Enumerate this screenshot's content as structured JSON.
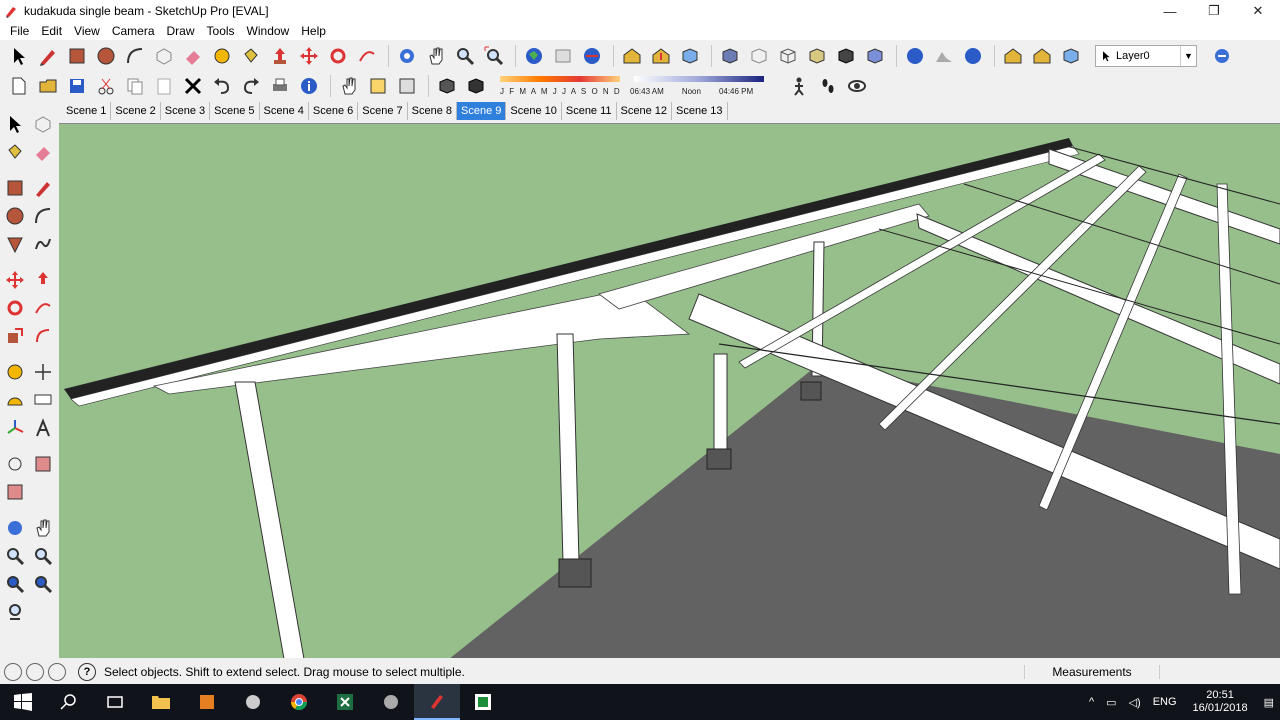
{
  "window": {
    "title": "kudakuda single beam - SketchUp Pro [EVAL]",
    "minimize_glyph": "—",
    "maximize_glyph": "❐",
    "close_glyph": "✕"
  },
  "menu": [
    "File",
    "Edit",
    "View",
    "Camera",
    "Draw",
    "Tools",
    "Window",
    "Help"
  ],
  "layer": {
    "selected": "Layer0"
  },
  "shadow": {
    "months": "J F M A M J J A S O N D",
    "time_start": "06:43 AM",
    "time_mid": "Noon",
    "time_end": "04:46 PM"
  },
  "scenes": [
    "Scene 1",
    "Scene 2",
    "Scene 3",
    "Scene 5",
    "Scene 4",
    "Scene 6",
    "Scene 7",
    "Scene 8",
    "Scene 9",
    "Scene 10",
    "Scene 11",
    "Scene 12",
    "Scene 13"
  ],
  "active_scene": "Scene 9",
  "status": {
    "text": "Select objects. Shift to extend select. Drag mouse to select multiple.",
    "help_glyph": "?",
    "measurements_label": "Measurements"
  },
  "taskbar": {
    "language": "ENG",
    "time": "20:51",
    "date": "16/01/2018"
  },
  "colors": {
    "sky": "#97bf8c",
    "ground": "#626262",
    "active_scene": "#2f7fdd",
    "taskbar": "#10141a"
  }
}
